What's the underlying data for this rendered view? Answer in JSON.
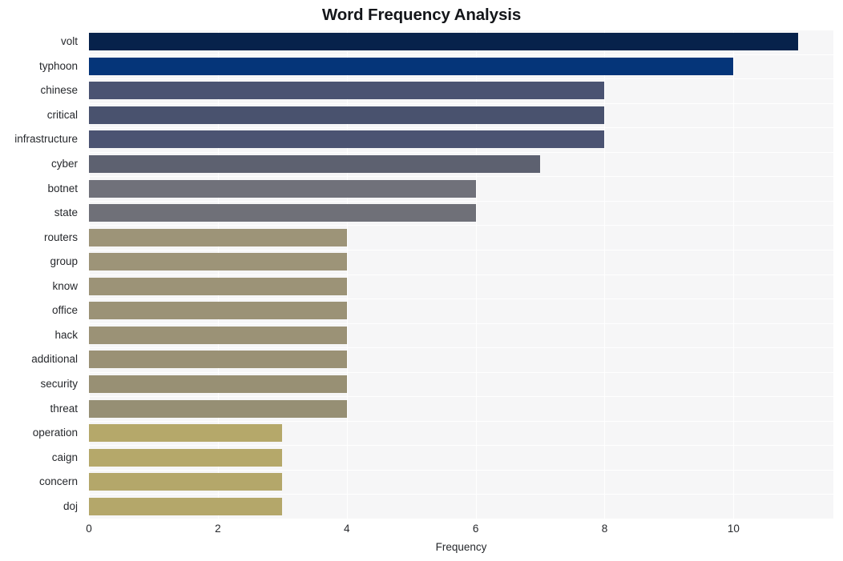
{
  "chart_data": {
    "type": "bar",
    "orientation": "horizontal",
    "title": "Word Frequency Analysis",
    "xlabel": "Frequency",
    "ylabel": "",
    "xlim": [
      0,
      11.55
    ],
    "xticks": [
      0,
      2,
      4,
      6,
      8,
      10
    ],
    "xtick_labels": [
      "0",
      "2",
      "4",
      "6",
      "8",
      "10"
    ],
    "grid": true,
    "legend": null,
    "categories": [
      "volt",
      "typhoon",
      "chinese",
      "critical",
      "infrastructure",
      "cyber",
      "botnet",
      "state",
      "routers",
      "group",
      "know",
      "office",
      "hack",
      "additional",
      "security",
      "threat",
      "operation",
      "caign",
      "concern",
      "doj"
    ],
    "values": [
      11,
      10,
      8,
      8,
      8,
      7,
      6,
      6,
      4,
      4,
      4,
      4,
      4,
      4,
      4,
      4,
      3,
      3,
      3,
      3
    ],
    "bar_colors": [
      "#07224b",
      "#053579",
      "#4a5372",
      "#49526e",
      "#4b5372",
      "#5d6170",
      "#70717a",
      "#6f7078",
      "#9d9478",
      "#9d9478",
      "#9c9377",
      "#9b9276",
      "#9b9276",
      "#9a9175",
      "#989074",
      "#968f74",
      "#b5a86a",
      "#b5a86a",
      "#b4a76a",
      "#b4a76a"
    ],
    "plot_background": "#f6f6f7",
    "figure_background": "#ffffff",
    "gridline_color": "#ffffff"
  }
}
